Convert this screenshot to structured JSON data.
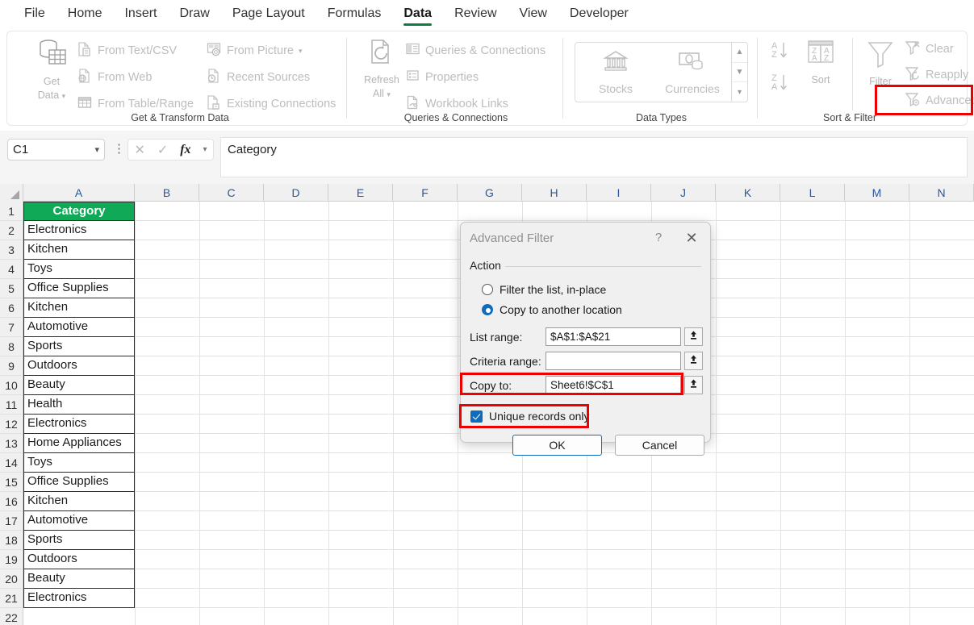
{
  "ribbon_tabs": [
    {
      "label": "File",
      "active": false
    },
    {
      "label": "Home",
      "active": false
    },
    {
      "label": "Insert",
      "active": false
    },
    {
      "label": "Draw",
      "active": false
    },
    {
      "label": "Page Layout",
      "active": false
    },
    {
      "label": "Formulas",
      "active": false
    },
    {
      "label": "Data",
      "active": true
    },
    {
      "label": "Review",
      "active": false
    },
    {
      "label": "View",
      "active": false
    },
    {
      "label": "Developer",
      "active": false
    }
  ],
  "ribbon": {
    "groups": [
      {
        "title": "Get & Transform Data",
        "big_button": {
          "label_line1": "Get",
          "label_line2": "Data",
          "icon": "database-table-icon",
          "has_chevron": true
        },
        "items": [
          {
            "label": "From Text/CSV",
            "icon": "text-csv-file-icon"
          },
          {
            "label": "From Web",
            "icon": "web-globe-file-icon"
          },
          {
            "label": "From Table/Range",
            "icon": "table-range-icon"
          },
          {
            "label": "From Picture",
            "icon": "picture-camera-icon",
            "has_chevron": true
          },
          {
            "label": "Recent Sources",
            "icon": "recent-clock-file-icon"
          },
          {
            "label": "Existing Connections",
            "icon": "existing-connections-icon"
          }
        ]
      },
      {
        "title": "Queries & Connections",
        "big_button": {
          "label_line1": "Refresh",
          "label_line2": "All",
          "icon": "refresh-all-icon",
          "has_chevron": true
        },
        "items": [
          {
            "label": "Queries & Connections",
            "icon": "queries-panel-icon"
          },
          {
            "label": "Properties",
            "icon": "properties-icon"
          },
          {
            "label": "Workbook Links",
            "icon": "workbook-links-icon"
          }
        ]
      },
      {
        "title": "Data Types",
        "gallery": [
          {
            "label": "Stocks",
            "icon": "bank-stocks-icon"
          },
          {
            "label": "Currencies",
            "icon": "currency-money-icon"
          }
        ],
        "scroll_icons": [
          "chevron-up-icon",
          "chevron-down-icon",
          "gallery-more-icon"
        ]
      },
      {
        "title": "Sort & Filter",
        "sort_az": {
          "label": "A\nZ",
          "icon": "sort-ascending-icon"
        },
        "sort_za": {
          "label": "Z\nA",
          "icon": "sort-descending-icon"
        },
        "sort_button": {
          "label": "Sort",
          "icon": "sort-dialog-icon"
        },
        "filter_button": {
          "label": "Filter",
          "icon": "funnel-filter-icon"
        },
        "items": [
          {
            "label": "Clear",
            "icon": "filter-clear-icon"
          },
          {
            "label": "Reapply",
            "icon": "filter-reapply-icon"
          },
          {
            "label": "Advanced",
            "icon": "filter-advanced-icon",
            "highlighted": true
          }
        ]
      }
    ]
  },
  "formula_bar": {
    "name_box_value": "C1",
    "name_box_chevron": "chevron-down-icon",
    "cancel_icon": "cancel-x-icon",
    "enter_icon": "enter-check-icon",
    "function_icon": "fx-insert-function-icon",
    "function_chevron": "chevron-down-icon",
    "formula_value": "Category"
  },
  "grid": {
    "columns": [
      "A",
      "B",
      "C",
      "D",
      "E",
      "F",
      "G",
      "H",
      "I",
      "J",
      "K",
      "L",
      "M",
      "N"
    ],
    "column_a_header": "Category",
    "rows": [
      {
        "num": "1",
        "value": "Category",
        "is_header": true
      },
      {
        "num": "2",
        "value": "Electronics",
        "is_header": false
      },
      {
        "num": "3",
        "value": "Kitchen",
        "is_header": false
      },
      {
        "num": "4",
        "value": "Toys",
        "is_header": false
      },
      {
        "num": "5",
        "value": "Office Supplies",
        "is_header": false
      },
      {
        "num": "6",
        "value": "Kitchen",
        "is_header": false
      },
      {
        "num": "7",
        "value": "Automotive",
        "is_header": false
      },
      {
        "num": "8",
        "value": "Sports",
        "is_header": false
      },
      {
        "num": "9",
        "value": "Outdoors",
        "is_header": false
      },
      {
        "num": "10",
        "value": "Beauty",
        "is_header": false
      },
      {
        "num": "11",
        "value": "Health",
        "is_header": false
      },
      {
        "num": "12",
        "value": "Electronics",
        "is_header": false
      },
      {
        "num": "13",
        "value": "Home Appliances",
        "is_header": false
      },
      {
        "num": "14",
        "value": "Toys",
        "is_header": false
      },
      {
        "num": "15",
        "value": "Office Supplies",
        "is_header": false
      },
      {
        "num": "16",
        "value": "Kitchen",
        "is_header": false
      },
      {
        "num": "17",
        "value": "Automotive",
        "is_header": false
      },
      {
        "num": "18",
        "value": "Sports",
        "is_header": false
      },
      {
        "num": "19",
        "value": "Outdoors",
        "is_header": false
      },
      {
        "num": "20",
        "value": "Beauty",
        "is_header": false
      },
      {
        "num": "21",
        "value": "Electronics",
        "is_header": false
      },
      {
        "num": "22",
        "value": "",
        "is_header": false
      }
    ]
  },
  "dialog": {
    "title": "Advanced Filter",
    "help_label": "?",
    "close_icon": "close-x-icon",
    "action_group_label": "Action",
    "radio_filter_inplace": {
      "label": "Filter the list, in-place",
      "selected": false
    },
    "radio_copy_another": {
      "label": "Copy to another location",
      "selected": true
    },
    "list_range": {
      "label": "List range:",
      "value": "$A$1:$A$21",
      "picker_icon": "range-picker-icon"
    },
    "criteria_range": {
      "label": "Criteria range:",
      "value": "",
      "picker_icon": "range-picker-icon"
    },
    "copy_to": {
      "label": "Copy to:",
      "value": "Sheet6!$C$1",
      "picker_icon": "range-picker-icon",
      "highlighted": true
    },
    "unique_records": {
      "label": "Unique records only",
      "checked": true,
      "highlighted": true
    },
    "ok_button": "OK",
    "cancel_button": "Cancel"
  },
  "colors": {
    "accent_green": "#107C41",
    "header_fill": "#0FA958",
    "highlight_red": "#EE0000",
    "selection_blue": "#0F6CBD"
  }
}
